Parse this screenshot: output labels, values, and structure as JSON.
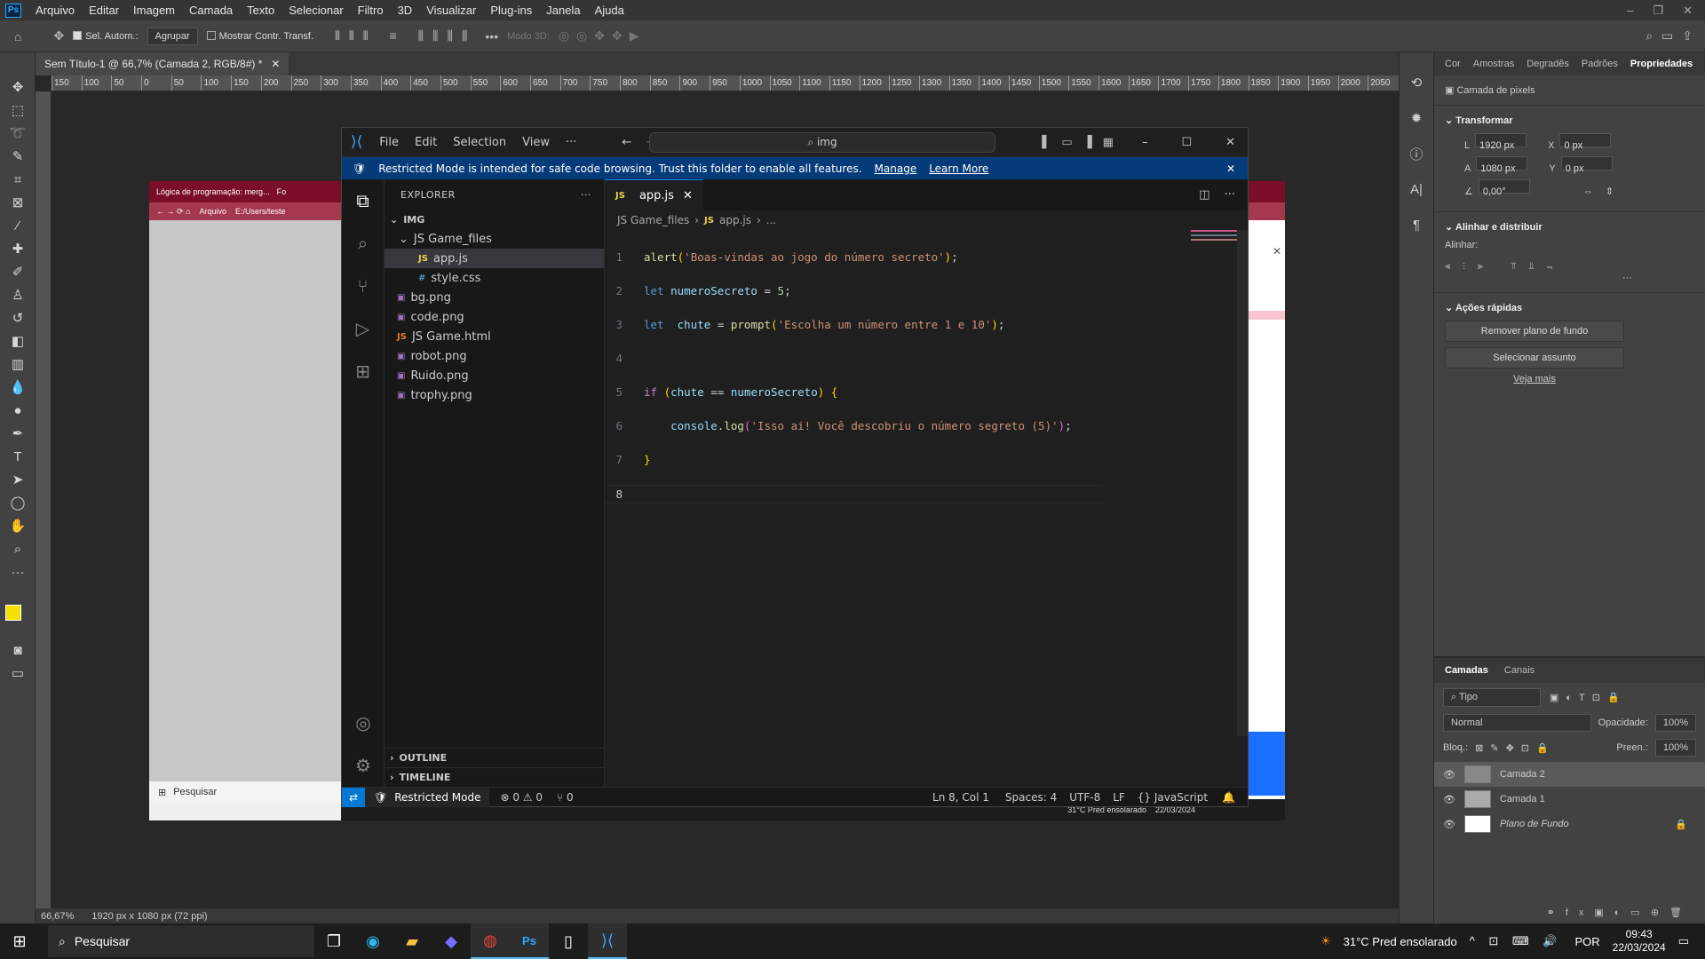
{
  "ps": {
    "menu": [
      "Arquivo",
      "Editar",
      "Imagem",
      "Camada",
      "Texto",
      "Selecionar",
      "Filtro",
      "3D",
      "Visualizar",
      "Plug-ins",
      "Janela",
      "Ajuda"
    ],
    "options": {
      "auto_select": "Sel. Autom.:",
      "group": "Agrupar",
      "show_transform": "Mostrar Contr. Transf.",
      "mode3d": "Modo 3D:"
    },
    "doc_tab": "Sem Título-1 @ 66,7% (Camada 2, RGB/8#) *",
    "ruler": [
      "150",
      "100",
      "50",
      "0",
      "50",
      "100",
      "150",
      "200",
      "250",
      "300",
      "350",
      "400",
      "450",
      "500",
      "550",
      "600",
      "650",
      "700",
      "750",
      "800",
      "850",
      "900",
      "950",
      "1000",
      "1050",
      "1100",
      "1150",
      "1200",
      "1250",
      "1300",
      "1350",
      "1400",
      "1450",
      "1500",
      "1550",
      "1600",
      "1650",
      "1700",
      "1750",
      "1800",
      "1850",
      "1900",
      "1950",
      "2000",
      "2050"
    ],
    "status": {
      "zoom": "66,67%",
      "info": "1920 px x 1080 px (72 ppi)"
    },
    "props": {
      "tabs": [
        "Cor",
        "Amostras",
        "Degradês",
        "Padrões",
        "Propriedades"
      ],
      "pixel_layer": "Camada de pixels",
      "transform": "Transformar",
      "L": "1920 px",
      "A": "1080 px",
      "X": "0 px",
      "Y": "0 px",
      "angle": "0,00°",
      "align_title": "Alinhar e distribuir",
      "align_label": "Alinhar:",
      "quick_title": "Ações rápidas",
      "btn_remove": "Remover plano de fundo",
      "btn_select": "Selecionar assunto",
      "more": "Veja mais"
    },
    "layers": {
      "tabs": [
        "Camadas",
        "Canais"
      ],
      "kind": "Tipo",
      "blend": "Normal",
      "opacity_label": "Opacidade:",
      "opacity": "100%",
      "lock_label": "Bloq.:",
      "fill_label": "Preen.:",
      "fill": "100%",
      "items": [
        "Camada 2",
        "Camada 1",
        "Plano de Fundo"
      ]
    }
  },
  "browser": {
    "tab1": "Lógica de programação: merg...",
    "tab2": "Fo",
    "file_label": "Arquivo",
    "path": "E:/Users/teste",
    "search": "Pesquisar",
    "weather": "31°C Pred ensolarado",
    "date": "22/03/2024"
  },
  "vscode": {
    "menu": [
      "File",
      "Edit",
      "Selection",
      "View",
      "···"
    ],
    "search": "img",
    "banner": {
      "text": "Restricted Mode is intended for safe code browsing. Trust this folder to enable all features.",
      "manage": "Manage",
      "learn": "Learn More"
    },
    "explorer": "EXPLORER",
    "root": "IMG",
    "folder": "JS Game_files",
    "files_in": [
      {
        "icon": "JS",
        "name": "app.js",
        "color": "#e8d44d"
      },
      {
        "icon": "#",
        "name": "style.css",
        "color": "#519aba"
      }
    ],
    "files": [
      {
        "icon": "▣",
        "name": "bg.png"
      },
      {
        "icon": "▣",
        "name": "code.png"
      },
      {
        "icon": "JS",
        "name": "JS Game.html"
      },
      {
        "icon": "▣",
        "name": "robot.png"
      },
      {
        "icon": "▣",
        "name": "Ruido.png"
      },
      {
        "icon": "▣",
        "name": "trophy.png"
      }
    ],
    "outline": "OUTLINE",
    "timeline": "TIMELINE",
    "tab": "app.js",
    "crumb": [
      "JS Game_files",
      "app.js",
      "..."
    ],
    "lines": [
      "1",
      "2",
      "3",
      "4",
      "5",
      "6",
      "7",
      "8"
    ],
    "status": {
      "mode": "Restricted Mode",
      "problems": "⊗ 0 ⚠ 0",
      "ports": "⑂ 0",
      "pos": "Ln 8, Col 1",
      "spaces": "Spaces: 4",
      "enc": "UTF-8",
      "eol": "LF",
      "lang": "{} JavaScript"
    }
  },
  "taskbar": {
    "search": "Pesquisar",
    "weather": "31°C  Pred ensolarado",
    "lang": "POR",
    "time": "09:43",
    "date": "22/03/2024"
  }
}
